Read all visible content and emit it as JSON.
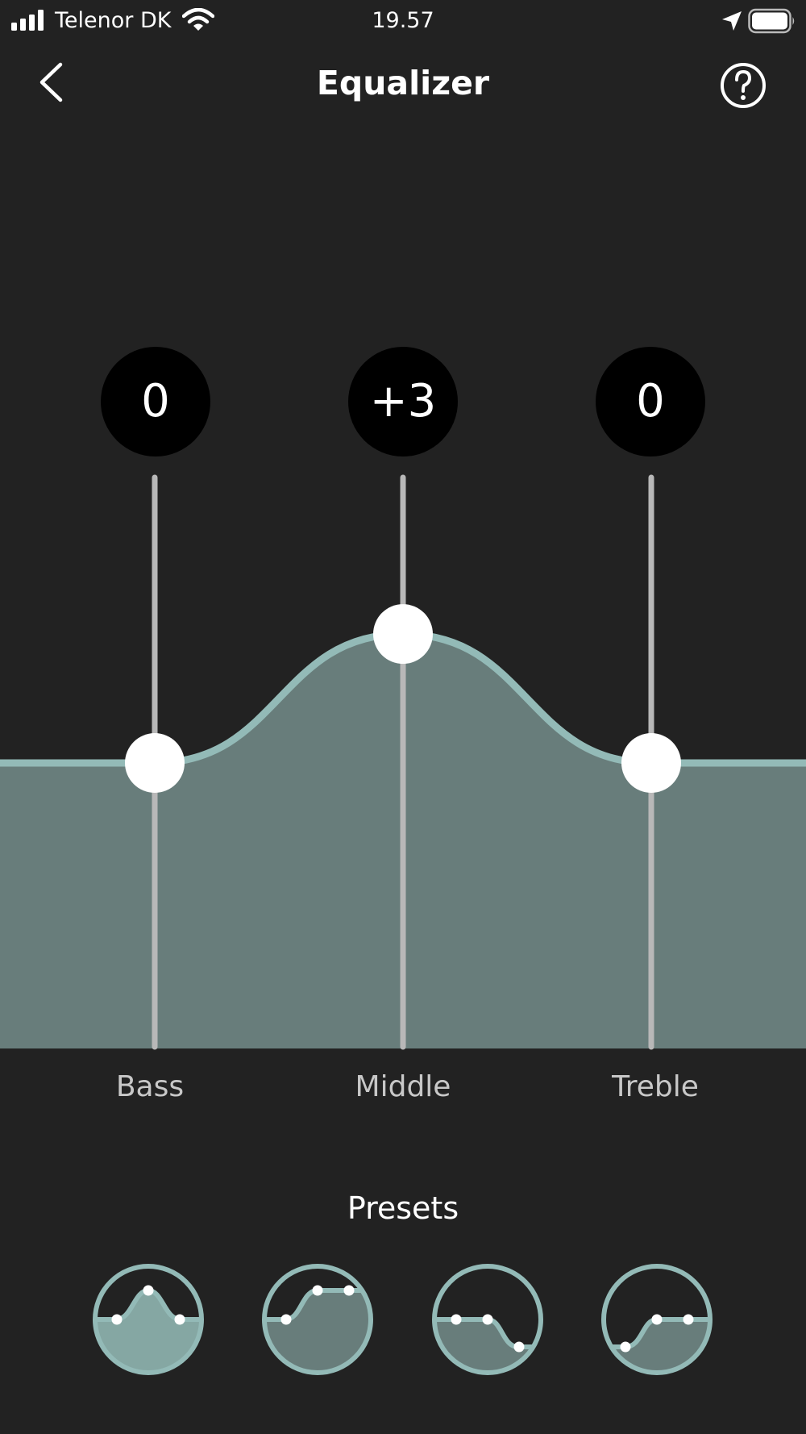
{
  "status_bar": {
    "carrier": "Telenor DK",
    "time": "19.57",
    "icons": [
      "signal-icon",
      "wifi-icon",
      "location-arrow-icon",
      "battery-icon"
    ]
  },
  "header": {
    "title": "Equalizer",
    "back_icon": "chevron-left-icon",
    "help_icon": "help-circle-icon"
  },
  "equalizer": {
    "colors": {
      "fill": "#687d7b",
      "curve": "#93bab7",
      "track": "#b8b8b8",
      "knob": "#ffffff",
      "badge": "#000000"
    },
    "bands": [
      {
        "label": "Bass",
        "value": 0,
        "display": "0"
      },
      {
        "label": "Middle",
        "value": 3,
        "display": "+3"
      },
      {
        "label": "Treble",
        "value": 0,
        "display": "0"
      }
    ]
  },
  "presets": {
    "title": "Presets",
    "items": [
      {
        "name": "preset-middle-boost",
        "selected": true
      },
      {
        "name": "preset-treble-boost",
        "selected": false
      },
      {
        "name": "preset-treble-cut",
        "selected": false
      },
      {
        "name": "preset-bass-cut",
        "selected": false
      }
    ]
  }
}
